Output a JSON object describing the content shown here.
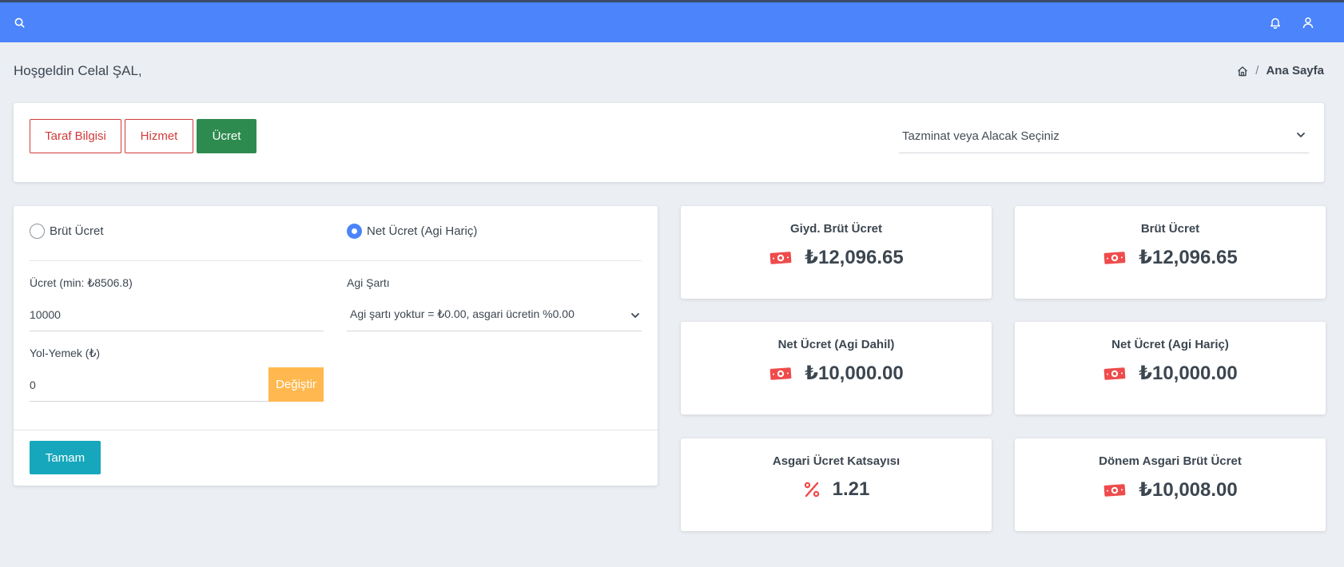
{
  "topbar": {
    "bg": "#4b84fb",
    "icons": [
      "search-icon",
      "bell-icon",
      "user-icon"
    ]
  },
  "welcome": "Hoşgeldin Celal ŞAL,",
  "breadcrumb": {
    "current": "Ana Sayfa",
    "separator": "/"
  },
  "tabs": {
    "taraf": "Taraf Bilgisi",
    "hizmet": "Hizmet",
    "ucret": "Ücret"
  },
  "select": {
    "placeholder": "Tazminat veya Alacak Seçiniz"
  },
  "form": {
    "radio_brut": "Brüt Ücret",
    "radio_net": "Net Ücret (Agi Hariç)",
    "ucret_label": "Ücret (min: ₺8506.8)",
    "ucret_value": "10000",
    "agi_label": "Agi Şartı",
    "agi_value": "Agi şartı yoktur = ₺0.00, asgari ücretin %0.00",
    "yol_label": "Yol-Yemek (₺)",
    "yol_value": "0",
    "degistir": "Değiştir",
    "tamam": "Tamam"
  },
  "stats": {
    "giyd_brut": {
      "title": "Giyd. Brüt Ücret",
      "value": "₺12,096.65",
      "icon": "money-icon"
    },
    "brut": {
      "title": "Brüt Ücret",
      "value": "₺12,096.65",
      "icon": "money-icon"
    },
    "net_dahil": {
      "title": "Net Ücret (Agi Dahil)",
      "value": "₺10,000.00",
      "icon": "money-icon"
    },
    "net_haric": {
      "title": "Net Ücret (Agi Hariç)",
      "value": "₺10,000.00",
      "icon": "money-icon"
    },
    "katsayi": {
      "title": "Asgari Ücret Katsayısı",
      "value": "1.21",
      "icon": "percent-icon"
    },
    "donem": {
      "title": "Dönem Asgari Brüt Ücret",
      "value": "₺10,008.00",
      "icon": "money-icon"
    }
  },
  "colors": {
    "accent": "#4b84fb",
    "danger": "#d23a3a",
    "success": "#2e8b4f",
    "warning": "#ffb84f",
    "info": "#16a7bd",
    "money": "#ef4b4b"
  }
}
